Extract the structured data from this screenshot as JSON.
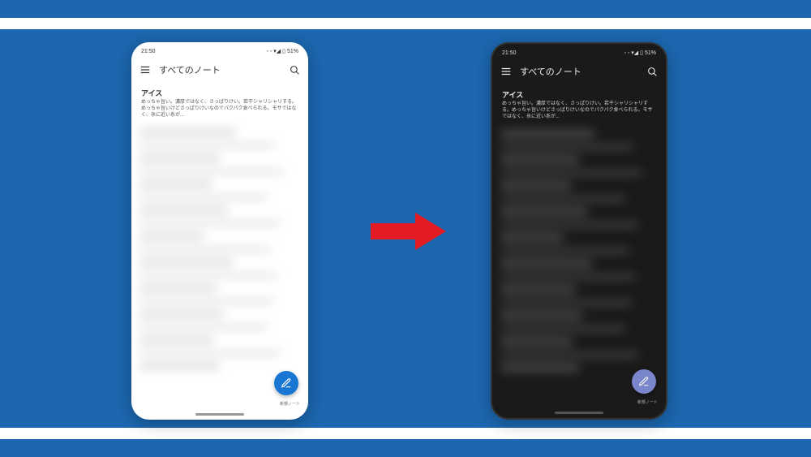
{
  "status": {
    "time_light": "21:50",
    "time_dark": "21:50",
    "battery": "51%",
    "icons": "◦ ◦ ▾◢ ▯"
  },
  "header": {
    "title": "すべてのノート"
  },
  "note": {
    "title": "アイス",
    "excerpt_light": "めっちゃ旨い。濃厚ではなく、さっぱりけい。若干シャリシャリする。めっちゃ旨いけどさっぱりけいなのでパクパク食べられる。モサではなく、氷に近い系が...",
    "excerpt_dark": "めっちゃ旨い。濃厚ではなく、さっぱりけい。若干シャリシャリする。めっちゃ旨いけどさっぱりけいなのでパクパク食べられる。モサではなく、氷に近い系が..."
  },
  "fab": {
    "label": "新規ノート"
  }
}
